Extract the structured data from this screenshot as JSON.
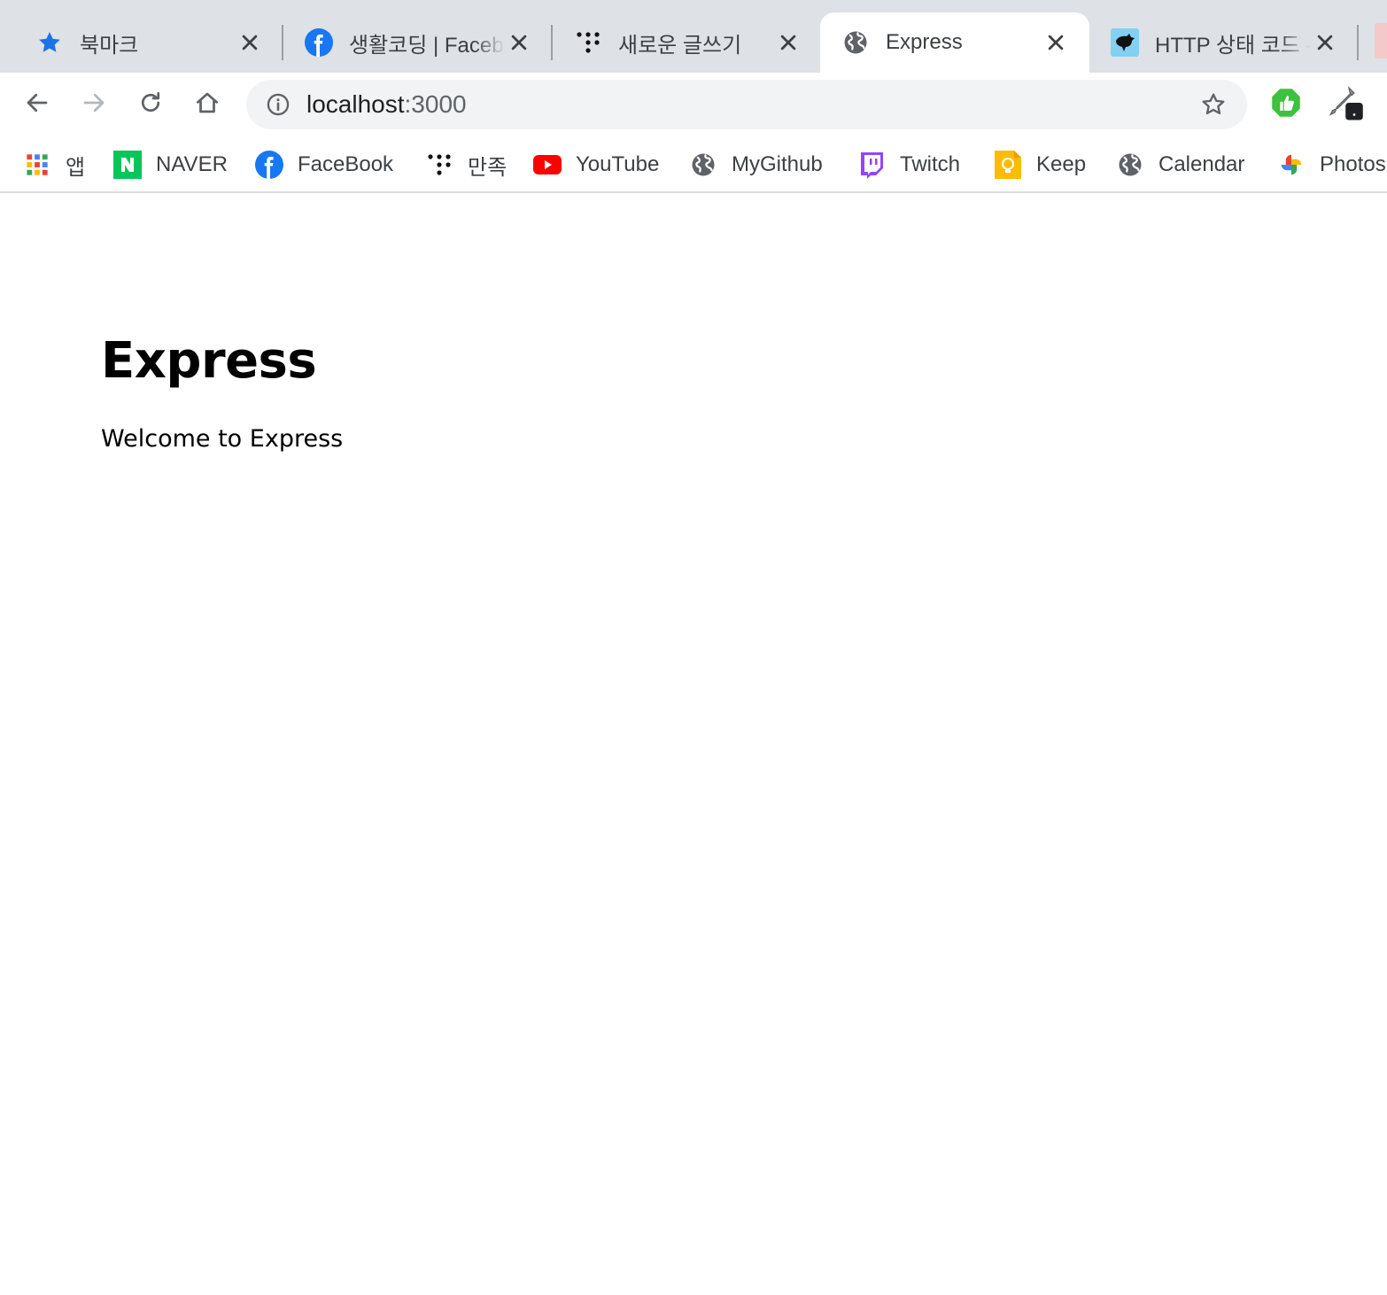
{
  "tabs": [
    {
      "title": "북마크",
      "favicon": "bookmark-star-icon",
      "active": false
    },
    {
      "title": "생활코딩 | Facebook",
      "favicon": "facebook-icon",
      "active": false
    },
    {
      "title": "새로운 글쓰기",
      "favicon": "tistory-icon",
      "active": false
    },
    {
      "title": "Express",
      "favicon": "globe-icon",
      "active": true
    },
    {
      "title": "HTTP 상태 코드 - HTTP | MDN",
      "favicon": "mdn-icon",
      "active": false
    }
  ],
  "toolbar": {
    "url_host": "localhost",
    "url_port": ":3000"
  },
  "bookmarks": [
    {
      "label": "앱",
      "icon": "apps-grid-icon"
    },
    {
      "label": "NAVER",
      "icon": "naver-icon"
    },
    {
      "label": "FaceBook",
      "icon": "facebook-icon"
    },
    {
      "label": "만족",
      "icon": "tistory-icon"
    },
    {
      "label": "YouTube",
      "icon": "youtube-icon"
    },
    {
      "label": "MyGithub",
      "icon": "globe-icon"
    },
    {
      "label": "Twitch",
      "icon": "twitch-icon"
    },
    {
      "label": "Keep",
      "icon": "keep-icon"
    },
    {
      "label": "Calendar",
      "icon": "globe-icon"
    },
    {
      "label": "Photos",
      "icon": "photos-icon"
    }
  ],
  "page": {
    "heading": "Express",
    "paragraph": "Welcome to Express"
  },
  "colors": {
    "tabstrip_bg": "#dee1e6",
    "omnibox_bg": "#f1f3f4",
    "facebook_blue": "#1877f2",
    "youtube_red": "#ff0000",
    "twitch_purple": "#9146ff",
    "naver_green": "#03c75a",
    "keep_yellow": "#fbbc04",
    "extension_green": "#3cc23c"
  }
}
